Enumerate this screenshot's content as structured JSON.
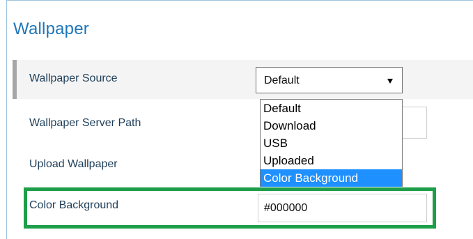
{
  "page": {
    "title": "Wallpaper"
  },
  "rows": {
    "wallpaper_source": "Wallpaper Source",
    "server_path": "Wallpaper Server Path",
    "upload": "Upload Wallpaper",
    "color_background": "Color Background"
  },
  "source_select": {
    "value": "Default",
    "options": [
      "Default",
      "Download",
      "USB",
      "Uploaded",
      "Color Background"
    ],
    "highlighted_option": "Color Background"
  },
  "color_field": {
    "value": "#000000"
  },
  "colors": {
    "title": "#1f76b8",
    "highlight_box": "#1e9e4a",
    "selected_option": "#1e90ff"
  }
}
